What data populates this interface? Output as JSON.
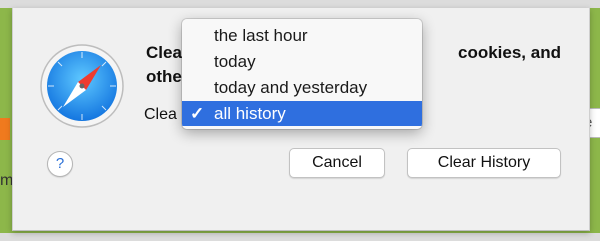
{
  "background": {
    "left_fragment": "me",
    "right_field_fragment": "Se"
  },
  "dialog": {
    "heading_line1_start": "Clea",
    "heading_line1_end": "cookies, and",
    "heading_line2": "othe",
    "clear_label": "Clea",
    "help_label": "?",
    "cancel_label": "Cancel",
    "clear_history_label": "Clear History"
  },
  "menu": {
    "check_glyph": "✓",
    "items": [
      {
        "label": "the last hour"
      },
      {
        "label": "today"
      },
      {
        "label": "today and yesterday"
      },
      {
        "label": "all history"
      }
    ],
    "selected_index": 3
  },
  "colors": {
    "selection": "#2f6fdf",
    "help_accent": "#2a6fd6",
    "background_green": "#8db74a"
  }
}
